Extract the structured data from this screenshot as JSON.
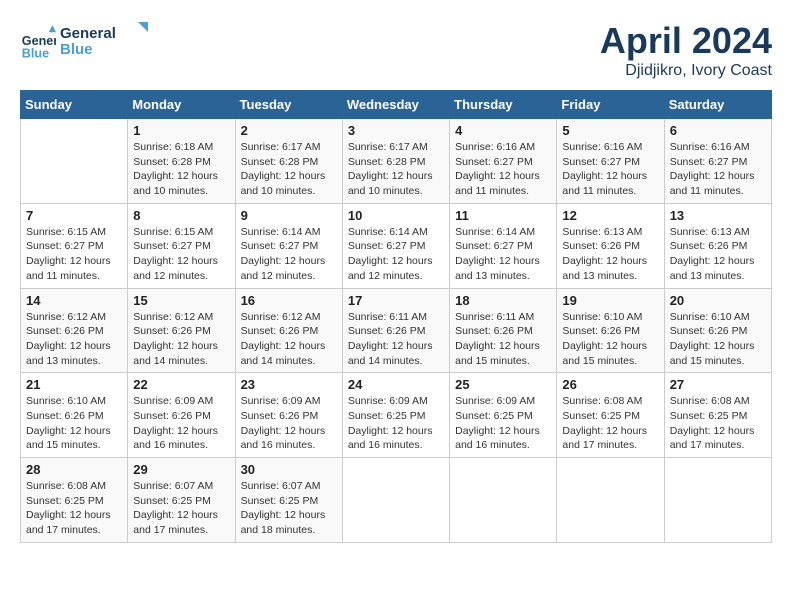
{
  "header": {
    "logo_line1": "General",
    "logo_line2": "Blue",
    "month": "April 2024",
    "location": "Djidjikro, Ivory Coast"
  },
  "days_of_week": [
    "Sunday",
    "Monday",
    "Tuesday",
    "Wednesday",
    "Thursday",
    "Friday",
    "Saturday"
  ],
  "weeks": [
    [
      {
        "day": "",
        "sunrise": "",
        "sunset": "",
        "daylight": ""
      },
      {
        "day": "1",
        "sunrise": "Sunrise: 6:18 AM",
        "sunset": "Sunset: 6:28 PM",
        "daylight": "Daylight: 12 hours and 10 minutes."
      },
      {
        "day": "2",
        "sunrise": "Sunrise: 6:17 AM",
        "sunset": "Sunset: 6:28 PM",
        "daylight": "Daylight: 12 hours and 10 minutes."
      },
      {
        "day": "3",
        "sunrise": "Sunrise: 6:17 AM",
        "sunset": "Sunset: 6:28 PM",
        "daylight": "Daylight: 12 hours and 10 minutes."
      },
      {
        "day": "4",
        "sunrise": "Sunrise: 6:16 AM",
        "sunset": "Sunset: 6:27 PM",
        "daylight": "Daylight: 12 hours and 11 minutes."
      },
      {
        "day": "5",
        "sunrise": "Sunrise: 6:16 AM",
        "sunset": "Sunset: 6:27 PM",
        "daylight": "Daylight: 12 hours and 11 minutes."
      },
      {
        "day": "6",
        "sunrise": "Sunrise: 6:16 AM",
        "sunset": "Sunset: 6:27 PM",
        "daylight": "Daylight: 12 hours and 11 minutes."
      }
    ],
    [
      {
        "day": "7",
        "sunrise": "Sunrise: 6:15 AM",
        "sunset": "Sunset: 6:27 PM",
        "daylight": "Daylight: 12 hours and 11 minutes."
      },
      {
        "day": "8",
        "sunrise": "Sunrise: 6:15 AM",
        "sunset": "Sunset: 6:27 PM",
        "daylight": "Daylight: 12 hours and 12 minutes."
      },
      {
        "day": "9",
        "sunrise": "Sunrise: 6:14 AM",
        "sunset": "Sunset: 6:27 PM",
        "daylight": "Daylight: 12 hours and 12 minutes."
      },
      {
        "day": "10",
        "sunrise": "Sunrise: 6:14 AM",
        "sunset": "Sunset: 6:27 PM",
        "daylight": "Daylight: 12 hours and 12 minutes."
      },
      {
        "day": "11",
        "sunrise": "Sunrise: 6:14 AM",
        "sunset": "Sunset: 6:27 PM",
        "daylight": "Daylight: 12 hours and 13 minutes."
      },
      {
        "day": "12",
        "sunrise": "Sunrise: 6:13 AM",
        "sunset": "Sunset: 6:26 PM",
        "daylight": "Daylight: 12 hours and 13 minutes."
      },
      {
        "day": "13",
        "sunrise": "Sunrise: 6:13 AM",
        "sunset": "Sunset: 6:26 PM",
        "daylight": "Daylight: 12 hours and 13 minutes."
      }
    ],
    [
      {
        "day": "14",
        "sunrise": "Sunrise: 6:12 AM",
        "sunset": "Sunset: 6:26 PM",
        "daylight": "Daylight: 12 hours and 13 minutes."
      },
      {
        "day": "15",
        "sunrise": "Sunrise: 6:12 AM",
        "sunset": "Sunset: 6:26 PM",
        "daylight": "Daylight: 12 hours and 14 minutes."
      },
      {
        "day": "16",
        "sunrise": "Sunrise: 6:12 AM",
        "sunset": "Sunset: 6:26 PM",
        "daylight": "Daylight: 12 hours and 14 minutes."
      },
      {
        "day": "17",
        "sunrise": "Sunrise: 6:11 AM",
        "sunset": "Sunset: 6:26 PM",
        "daylight": "Daylight: 12 hours and 14 minutes."
      },
      {
        "day": "18",
        "sunrise": "Sunrise: 6:11 AM",
        "sunset": "Sunset: 6:26 PM",
        "daylight": "Daylight: 12 hours and 15 minutes."
      },
      {
        "day": "19",
        "sunrise": "Sunrise: 6:10 AM",
        "sunset": "Sunset: 6:26 PM",
        "daylight": "Daylight: 12 hours and 15 minutes."
      },
      {
        "day": "20",
        "sunrise": "Sunrise: 6:10 AM",
        "sunset": "Sunset: 6:26 PM",
        "daylight": "Daylight: 12 hours and 15 minutes."
      }
    ],
    [
      {
        "day": "21",
        "sunrise": "Sunrise: 6:10 AM",
        "sunset": "Sunset: 6:26 PM",
        "daylight": "Daylight: 12 hours and 15 minutes."
      },
      {
        "day": "22",
        "sunrise": "Sunrise: 6:09 AM",
        "sunset": "Sunset: 6:26 PM",
        "daylight": "Daylight: 12 hours and 16 minutes."
      },
      {
        "day": "23",
        "sunrise": "Sunrise: 6:09 AM",
        "sunset": "Sunset: 6:26 PM",
        "daylight": "Daylight: 12 hours and 16 minutes."
      },
      {
        "day": "24",
        "sunrise": "Sunrise: 6:09 AM",
        "sunset": "Sunset: 6:25 PM",
        "daylight": "Daylight: 12 hours and 16 minutes."
      },
      {
        "day": "25",
        "sunrise": "Sunrise: 6:09 AM",
        "sunset": "Sunset: 6:25 PM",
        "daylight": "Daylight: 12 hours and 16 minutes."
      },
      {
        "day": "26",
        "sunrise": "Sunrise: 6:08 AM",
        "sunset": "Sunset: 6:25 PM",
        "daylight": "Daylight: 12 hours and 17 minutes."
      },
      {
        "day": "27",
        "sunrise": "Sunrise: 6:08 AM",
        "sunset": "Sunset: 6:25 PM",
        "daylight": "Daylight: 12 hours and 17 minutes."
      }
    ],
    [
      {
        "day": "28",
        "sunrise": "Sunrise: 6:08 AM",
        "sunset": "Sunset: 6:25 PM",
        "daylight": "Daylight: 12 hours and 17 minutes."
      },
      {
        "day": "29",
        "sunrise": "Sunrise: 6:07 AM",
        "sunset": "Sunset: 6:25 PM",
        "daylight": "Daylight: 12 hours and 17 minutes."
      },
      {
        "day": "30",
        "sunrise": "Sunrise: 6:07 AM",
        "sunset": "Sunset: 6:25 PM",
        "daylight": "Daylight: 12 hours and 18 minutes."
      },
      {
        "day": "",
        "sunrise": "",
        "sunset": "",
        "daylight": ""
      },
      {
        "day": "",
        "sunrise": "",
        "sunset": "",
        "daylight": ""
      },
      {
        "day": "",
        "sunrise": "",
        "sunset": "",
        "daylight": ""
      },
      {
        "day": "",
        "sunrise": "",
        "sunset": "",
        "daylight": ""
      }
    ]
  ]
}
